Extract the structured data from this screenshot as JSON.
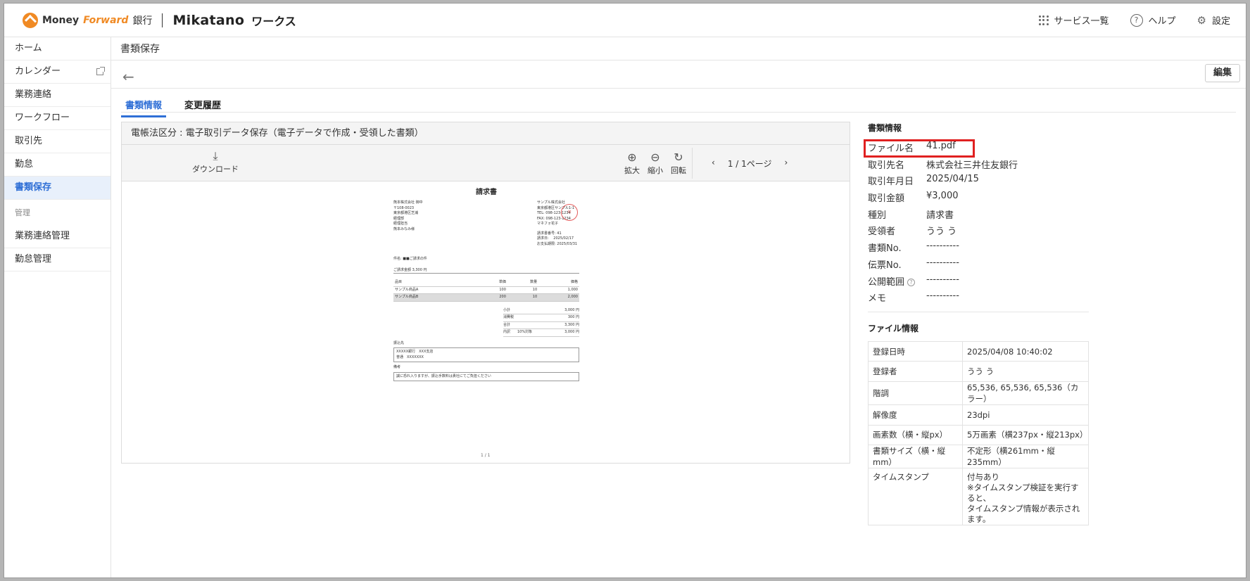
{
  "header": {
    "logo_money": "Money",
    "logo_forward": "Forward",
    "logo_bank": "銀行",
    "logo_mikatano": "Mikatano",
    "logo_works": "ワークス",
    "nav": [
      {
        "label": "サービス一覧",
        "icon": "grid-icon"
      },
      {
        "label": "ヘルプ",
        "icon": "help-icon"
      },
      {
        "label": "設定",
        "icon": "user-gear-icon"
      }
    ]
  },
  "sidebar": {
    "items": [
      {
        "label": "ホーム"
      },
      {
        "label": "カレンダー",
        "icon": "external-link-icon"
      },
      {
        "label": "業務連絡"
      },
      {
        "label": "ワークフロー"
      },
      {
        "label": "取引先"
      },
      {
        "label": "勤怠"
      },
      {
        "label": "書類保存",
        "active": true
      }
    ],
    "group_label": "管理",
    "admin_items": [
      {
        "label": "業務連絡管理"
      },
      {
        "label": "勤怠管理"
      }
    ]
  },
  "main": {
    "page_title": "書類保存",
    "edit_label": "編集",
    "tabs": [
      {
        "label": "書類情報",
        "active": true
      },
      {
        "label": "変更履歴"
      }
    ]
  },
  "viewer": {
    "category": "電帳法区分 : 電子取引データ保存（電子データで作成・受領した書類）",
    "download_label": "ダウンロード",
    "zoom_in_label": "拡大",
    "zoom_out_label": "縮小",
    "rotate_label": "回転",
    "page_indicator": "1 / 1ページ",
    "page_footer": "1 / 1"
  },
  "document": {
    "title": "請求書",
    "to_company": "熊本株式会社 御中",
    "to_address": [
      "〒108-0023",
      "東京都港区芝浦",
      "経理部",
      "経理担当",
      "熊本みなみ様"
    ],
    "from_company": "サンプル株式会社",
    "from_address": [
      "東京都港区サンプル1-1",
      "TEL: 098-123-1234",
      "FAX: 098-123-1234",
      "マネフォ花子"
    ],
    "invoice_meta": [
      "請求書番号: 41",
      "請求日:　 2025/02/17",
      "お支払期限: 2025/03/31"
    ],
    "subject": "件名: ■■ご請求の件",
    "amount_line": "ご請求金額 3,300 円",
    "col_headers": [
      "品目",
      "単価",
      "数量",
      "価格"
    ],
    "rows": [
      {
        "item": "サンプル商品A",
        "price": "100",
        "qty": "10",
        "total": "1,000"
      },
      {
        "item": "サンプル商品B",
        "price": "200",
        "qty": "10",
        "total": "2,000"
      }
    ],
    "sums": [
      {
        "label": "小計",
        "value": "3,000 円"
      },
      {
        "label": "消費税",
        "value": "300 円"
      },
      {
        "label": "合計",
        "value": "3,300 円"
      },
      {
        "label": "内訳　　10%対象",
        "value": "3,000 円"
      }
    ],
    "bank_label": "振込先",
    "bank_lines": [
      "XXXXX銀行　XXX支店",
      "普通　XXXXXXX"
    ],
    "note_label": "備考",
    "note_text": "誠に恐れ入りますが、振込手数料は貴社にてご負担ください"
  },
  "doc_info": {
    "title": "書類情報",
    "rows": [
      {
        "key": "ファイル名",
        "value": "41.pdf"
      },
      {
        "key": "取引先名",
        "value": "株式会社三井住友銀行"
      },
      {
        "key": "取引年月日",
        "value": "2025/04/15"
      },
      {
        "key": "取引金額",
        "value": "¥3,000"
      },
      {
        "key": "種別",
        "value": "請求書"
      },
      {
        "key": "受領者",
        "value": "うう う"
      },
      {
        "key": "書類No.",
        "value": "----------"
      },
      {
        "key": "伝票No.",
        "value": "----------"
      },
      {
        "key": "公開範囲",
        "value": "----------",
        "help": "?"
      },
      {
        "key": "メモ",
        "value": "----------"
      }
    ]
  },
  "file_info": {
    "title": "ファイル情報",
    "rows": [
      {
        "key": "登録日時",
        "value": "2025/04/08 10:40:02"
      },
      {
        "key": "登録者",
        "value": "うう う"
      },
      {
        "key": "階調",
        "value": "65,536, 65,536, 65,536（カラー）"
      },
      {
        "key": "解像度",
        "value": "23dpi"
      },
      {
        "key": "画素数（横・縦px）",
        "value": "5万画素（横237px・縦213px）"
      },
      {
        "key": "書類サイズ（横・縦mm）",
        "value": "不定形（横261mm・縦235mm）"
      }
    ],
    "timestamp_key": "タイムスタンプ",
    "timestamp_lines": [
      "付与あり",
      "※タイムスタンプ検証を実行すると、",
      "タイムスタンプ情報が表示されます。"
    ]
  }
}
